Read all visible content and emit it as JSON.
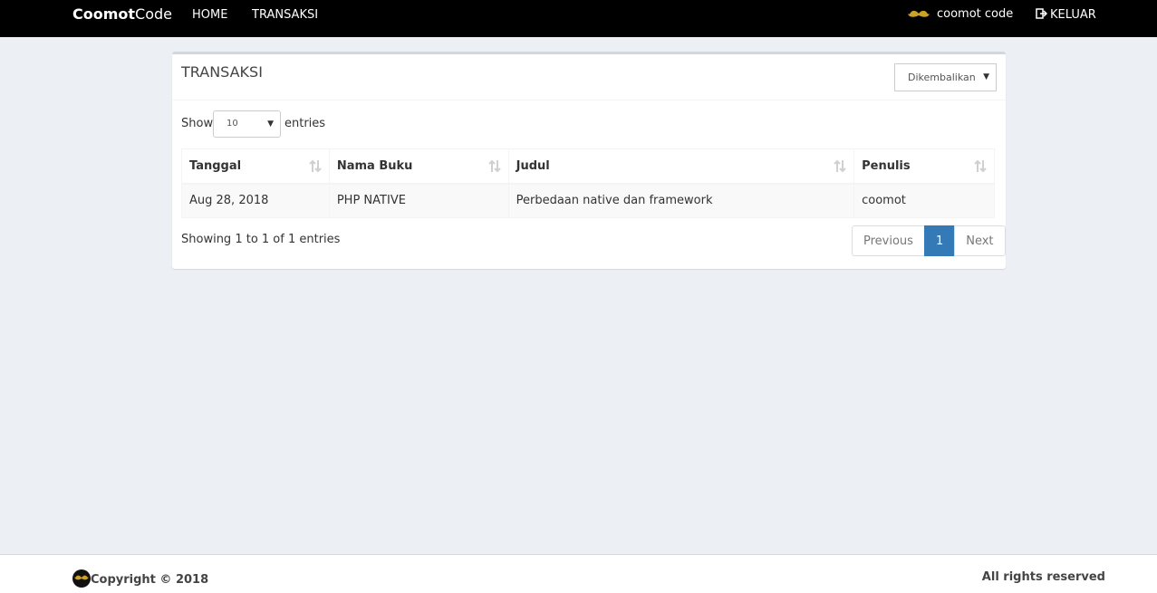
{
  "navbar": {
    "brand_bold": "Coomot",
    "brand_light": "Code",
    "links": [
      "HOME",
      "TRANSAKSI"
    ],
    "user_name": "coomot code",
    "logout_label": "KELUAR",
    "icons": {
      "user": "mustache-icon",
      "logout": "logout-icon"
    }
  },
  "box": {
    "title": "TRANSAKSI",
    "status_filter": {
      "selected": "Dikembalikan"
    }
  },
  "table_controls": {
    "show_label": "Show",
    "page_length": "10",
    "entries_label": "entries"
  },
  "table": {
    "columns": [
      "Tanggal",
      "Nama Buku",
      "Judul",
      "Penulis"
    ],
    "rows": [
      [
        "Aug 28, 2018",
        "PHP NATIVE",
        "Perbedaan native dan framework",
        "coomot"
      ]
    ]
  },
  "info": "Showing 1 to 1 of 1 entries",
  "pagination": {
    "previous": "Previous",
    "current": "1",
    "next": "Next"
  },
  "footer": {
    "copyright": "Copyright © 2018",
    "rights": "All rights reserved"
  },
  "colors": {
    "navbar_bg": "#000000",
    "page_bg": "#ecf0f5",
    "active_page": "#337ab7",
    "mustache": "#c9a227"
  }
}
